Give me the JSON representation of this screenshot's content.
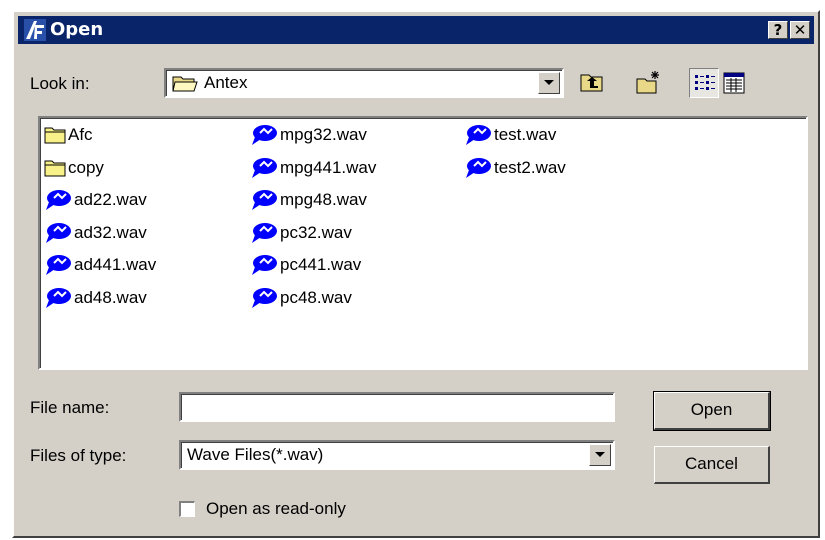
{
  "window": {
    "title": "Open",
    "help_label": "?",
    "close_label": "✕"
  },
  "lookin": {
    "label": "Look in:",
    "folder": "Antex"
  },
  "files": {
    "col1": [
      {
        "name": "Afc",
        "icon": "folder-icon"
      },
      {
        "name": "copy",
        "icon": "folder-icon"
      },
      {
        "name": "ad22.wav",
        "icon": "wave-file-icon"
      },
      {
        "name": "ad32.wav",
        "icon": "wave-file-icon"
      },
      {
        "name": "ad441.wav",
        "icon": "wave-file-icon"
      },
      {
        "name": "ad48.wav",
        "icon": "wave-file-icon"
      }
    ],
    "col2": [
      {
        "name": "mpg32.wav",
        "icon": "wave-file-icon"
      },
      {
        "name": "mpg441.wav",
        "icon": "wave-file-icon"
      },
      {
        "name": "mpg48.wav",
        "icon": "wave-file-icon"
      },
      {
        "name": "pc32.wav",
        "icon": "wave-file-icon"
      },
      {
        "name": "pc441.wav",
        "icon": "wave-file-icon"
      },
      {
        "name": "pc48.wav",
        "icon": "wave-file-icon"
      }
    ],
    "col3": [
      {
        "name": "test.wav",
        "icon": "wave-file-icon"
      },
      {
        "name": "test2.wav",
        "icon": "wave-file-icon"
      }
    ]
  },
  "filename": {
    "label": "File name:",
    "value": ""
  },
  "filetype": {
    "label": "Files of type:",
    "value": "Wave Files(*.wav)"
  },
  "buttons": {
    "open": "Open",
    "cancel": "Cancel"
  },
  "readonly": {
    "label": "Open as read-only",
    "checked": false
  },
  "colors": {
    "title_bar": "#0a246a",
    "face": "#d4d0c8",
    "wave_icon": "#0000ff"
  }
}
